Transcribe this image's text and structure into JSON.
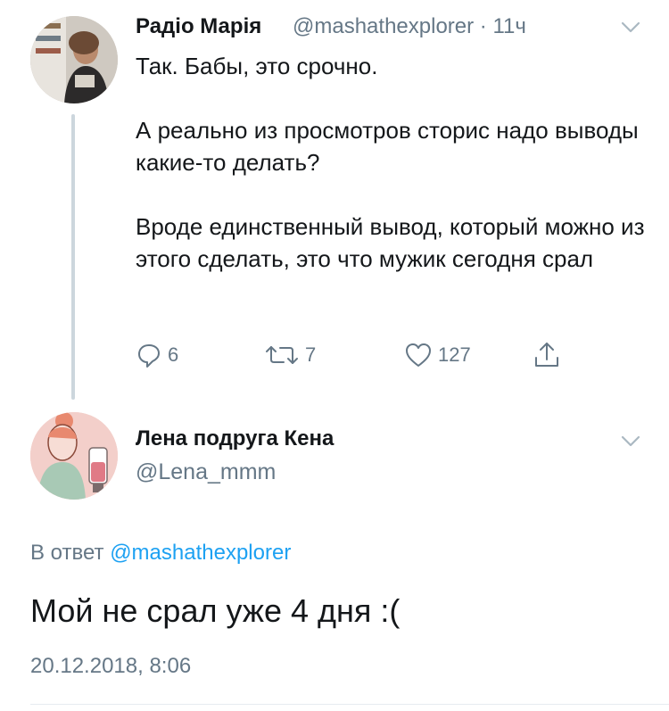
{
  "parent_tweet": {
    "display_name": "Радіо Марія",
    "handle": "@mashathexplorer",
    "separator": "·",
    "time": "11ч",
    "text": "Так. Бабы, это срочно.\n\nА реально из просмотров сторис надо выводы какие-то делать?\n\nВроде единственный вывод, который можно из этого сделать, это что мужик сегодня срал",
    "reply_count": "6",
    "retweet_count": "7",
    "like_count": "127"
  },
  "reply_tweet": {
    "display_name": "Лена подруга Кена",
    "handle": "@Lena_mmm",
    "in_reply_prefix": "В ответ",
    "in_reply_handle": "@mashathexplorer",
    "text": "Мой не срал уже 4 дня :(",
    "date": "20.12.2018, 8:06"
  },
  "icons": {
    "reply": "reply-icon",
    "retweet": "retweet-icon",
    "like": "heart-icon",
    "share": "share-icon",
    "menu": "chevron-down-icon"
  },
  "colors": {
    "text": "#14171a",
    "secondary": "#657786",
    "link": "#1da1f2",
    "thread_line": "#ccd6dd"
  }
}
